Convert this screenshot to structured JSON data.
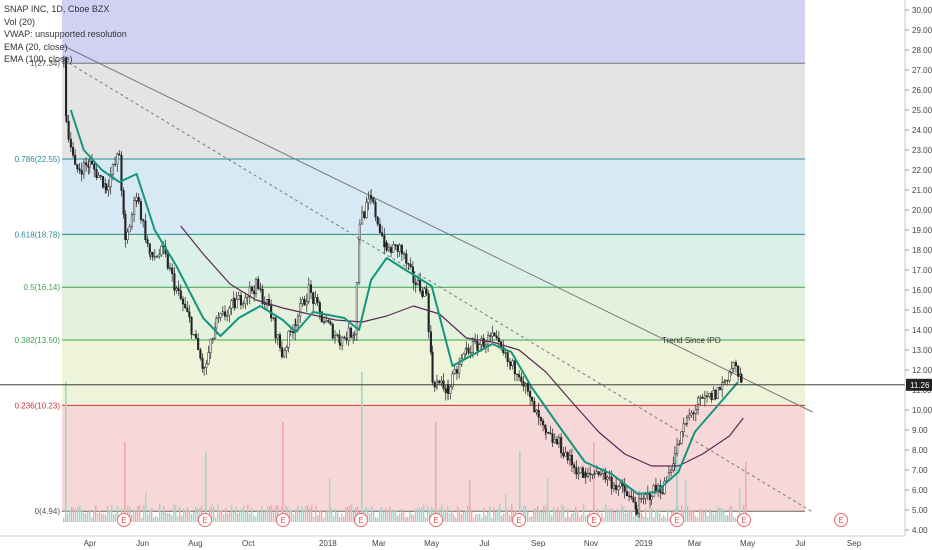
{
  "header": {
    "symbol_line": "SNAP INC, 1D, Cboe BZX",
    "indicators": [
      "Vol (20)",
      "VWAP: unsupported resolution",
      "EMA (20, close)",
      "EMA (100, close)"
    ]
  },
  "price_tag": "11.26",
  "annotation": "Trend Since IPO",
  "earnings_marker": "E",
  "colors": {
    "fib_100": "#d2d1f4",
    "fib_786": "#e4e4e4",
    "fib_618": "#d6e9f4",
    "fib_5": "#dbf0e6",
    "fib_382": "#e4f2dd",
    "fib_236": "#eef4d9",
    "fib_0": "#f6d8d8",
    "ema20": "#15957e",
    "ema100": "#5b2a54",
    "candle_up": "#333333",
    "candle_down": "#333333",
    "vol_up": "#9fd6c7",
    "vol_down": "#f3a8a8",
    "fib_label": "#2b8a8f"
  },
  "chart_data": {
    "type": "candlestick",
    "title": "SNAP INC, 1D, Cboe BZX",
    "y_axis": {
      "ticks": [
        "4.00",
        "5.00",
        "6.00",
        "7.00",
        "8.00",
        "9.00",
        "10.00",
        "11.00",
        "12.00",
        "13.00",
        "14.00",
        "15.00",
        "16.00",
        "17.00",
        "18.00",
        "19.00",
        "20.00",
        "21.00",
        "22.00",
        "23.00",
        "24.00",
        "25.00",
        "26.00",
        "27.00",
        "28.00",
        "29.00",
        "30.00"
      ],
      "range": [
        3.7,
        30.5
      ]
    },
    "x_axis": {
      "ticks": [
        "Apr",
        "Jun",
        "Aug",
        "Oct",
        "2018",
        "Mar",
        "May",
        "Jul",
        "Sep",
        "Nov",
        "2019",
        "Mar",
        "May",
        "Jul",
        "Sep"
      ]
    },
    "fibonacci": [
      {
        "label": "1(27.34)",
        "value": 27.34
      },
      {
        "label": "0.786(22.55)",
        "value": 22.55
      },
      {
        "label": "0.618(18.78)",
        "value": 18.78
      },
      {
        "label": "0.5(16.14)",
        "value": 16.14
      },
      {
        "label": "0.382(13.50)",
        "value": 13.5
      },
      {
        "label": "0.236(10.23)",
        "value": 10.23
      },
      {
        "label": "0(4.94)",
        "value": 4.94
      }
    ],
    "last_price": 11.26,
    "earnings_dates": [
      "2017-05",
      "2017-08",
      "2017-11",
      "2018-02",
      "2018-05",
      "2018-08",
      "2018-10",
      "2019-02",
      "2019-04",
      "2019-07"
    ],
    "price_path": [
      [
        "2017-03-02",
        27.5
      ],
      [
        "2017-03-05",
        24.5
      ],
      [
        "2017-03-15",
        22.0
      ],
      [
        "2017-04-01",
        22.3
      ],
      [
        "2017-04-20",
        21.2
      ],
      [
        "2017-05-05",
        22.8
      ],
      [
        "2017-05-12",
        18.3
      ],
      [
        "2017-05-25",
        20.8
      ],
      [
        "2017-06-10",
        17.6
      ],
      [
        "2017-06-25",
        17.9
      ],
      [
        "2017-07-10",
        16.0
      ],
      [
        "2017-07-25",
        14.5
      ],
      [
        "2017-08-11",
        11.9
      ],
      [
        "2017-08-25",
        14.3
      ],
      [
        "2017-09-15",
        15.3
      ],
      [
        "2017-10-10",
        16.2
      ],
      [
        "2017-10-25",
        15.1
      ],
      [
        "2017-11-09",
        12.8
      ],
      [
        "2017-11-25",
        14.5
      ],
      [
        "2017-12-10",
        16.0
      ],
      [
        "2017-12-25",
        14.6
      ],
      [
        "2018-01-15",
        13.5
      ],
      [
        "2018-02-01",
        14.0
      ],
      [
        "2018-02-07",
        19.5
      ],
      [
        "2018-02-20",
        20.5
      ],
      [
        "2018-03-10",
        18.0
      ],
      [
        "2018-03-25",
        18.1
      ],
      [
        "2018-04-10",
        16.5
      ],
      [
        "2018-04-25",
        15.8
      ],
      [
        "2018-05-02",
        11.5
      ],
      [
        "2018-05-20",
        11.0
      ],
      [
        "2018-06-10",
        13.0
      ],
      [
        "2018-06-25",
        13.3
      ],
      [
        "2018-07-10",
        13.6
      ],
      [
        "2018-07-31",
        12.2
      ],
      [
        "2018-08-10",
        12.0
      ],
      [
        "2018-08-25",
        10.2
      ],
      [
        "2018-09-10",
        8.7
      ],
      [
        "2018-09-25",
        8.3
      ],
      [
        "2018-10-10",
        7.3
      ],
      [
        "2018-10-26",
        6.6
      ],
      [
        "2018-11-10",
        7.0
      ],
      [
        "2018-11-25",
        6.4
      ],
      [
        "2018-12-10",
        5.9
      ],
      [
        "2018-12-24",
        5.1
      ],
      [
        "2019-01-10",
        5.9
      ],
      [
        "2019-01-25",
        6.2
      ],
      [
        "2019-02-06",
        7.8
      ],
      [
        "2019-02-20",
        9.5
      ],
      [
        "2019-03-05",
        10.3
      ],
      [
        "2019-03-25",
        10.8
      ],
      [
        "2019-04-05",
        11.5
      ],
      [
        "2019-04-15",
        12.3
      ],
      [
        "2019-04-24",
        11.3
      ],
      [
        "2019-04-26",
        11.26
      ]
    ],
    "ema20_path": [
      [
        "2017-03-10",
        25.0
      ],
      [
        "2017-03-25",
        23.0
      ],
      [
        "2017-04-15",
        22.0
      ],
      [
        "2017-05-05",
        21.4
      ],
      [
        "2017-05-25",
        21.8
      ],
      [
        "2017-06-15",
        19.0
      ],
      [
        "2017-07-10",
        17.2
      ],
      [
        "2017-08-10",
        14.6
      ],
      [
        "2017-08-30",
        13.7
      ],
      [
        "2017-09-20",
        14.6
      ],
      [
        "2017-10-15",
        15.2
      ],
      [
        "2017-11-10",
        14.5
      ],
      [
        "2017-11-25",
        13.9
      ],
      [
        "2017-12-15",
        14.9
      ],
      [
        "2018-01-20",
        14.6
      ],
      [
        "2018-02-06",
        14.0
      ],
      [
        "2018-02-20",
        16.5
      ],
      [
        "2018-03-10",
        17.6
      ],
      [
        "2018-04-01",
        17.0
      ],
      [
        "2018-05-01",
        16.2
      ],
      [
        "2018-05-25",
        12.2
      ],
      [
        "2018-06-15",
        12.7
      ],
      [
        "2018-07-10",
        13.3
      ],
      [
        "2018-08-01",
        12.9
      ],
      [
        "2018-08-25",
        11.1
      ],
      [
        "2018-09-25",
        9.2
      ],
      [
        "2018-10-25",
        7.4
      ],
      [
        "2018-11-25",
        6.8
      ],
      [
        "2018-12-25",
        5.8
      ],
      [
        "2019-01-15",
        5.9
      ],
      [
        "2019-02-10",
        6.9
      ],
      [
        "2019-03-01",
        8.9
      ],
      [
        "2019-03-25",
        10.1
      ],
      [
        "2019-04-20",
        11.4
      ]
    ],
    "ema100_path": [
      [
        "2017-07-15",
        19.2
      ],
      [
        "2017-08-10",
        17.8
      ],
      [
        "2017-09-10",
        16.3
      ],
      [
        "2017-10-10",
        15.5
      ],
      [
        "2017-11-10",
        15.1
      ],
      [
        "2017-12-10",
        14.8
      ],
      [
        "2018-01-10",
        14.5
      ],
      [
        "2018-02-10",
        14.4
      ],
      [
        "2018-03-10",
        14.7
      ],
      [
        "2018-04-10",
        15.2
      ],
      [
        "2018-05-10",
        14.8
      ],
      [
        "2018-06-10",
        13.6
      ],
      [
        "2018-07-10",
        13.4
      ],
      [
        "2018-08-10",
        13.0
      ],
      [
        "2018-09-10",
        11.9
      ],
      [
        "2018-10-10",
        10.4
      ],
      [
        "2018-11-10",
        8.9
      ],
      [
        "2018-12-10",
        7.8
      ],
      [
        "2019-01-10",
        7.2
      ],
      [
        "2019-02-10",
        7.2
      ],
      [
        "2019-03-10",
        7.8
      ],
      [
        "2019-04-10",
        8.7
      ],
      [
        "2019-04-26",
        9.6
      ]
    ],
    "trend_line": {
      "from": [
        "2017-03-02",
        28.2
      ],
      "to": [
        "2019-07-15",
        9.9
      ]
    },
    "dashed_trend": {
      "from": [
        "2017-03-02",
        27.5
      ],
      "to": [
        "2019-07-15",
        4.9
      ]
    }
  }
}
